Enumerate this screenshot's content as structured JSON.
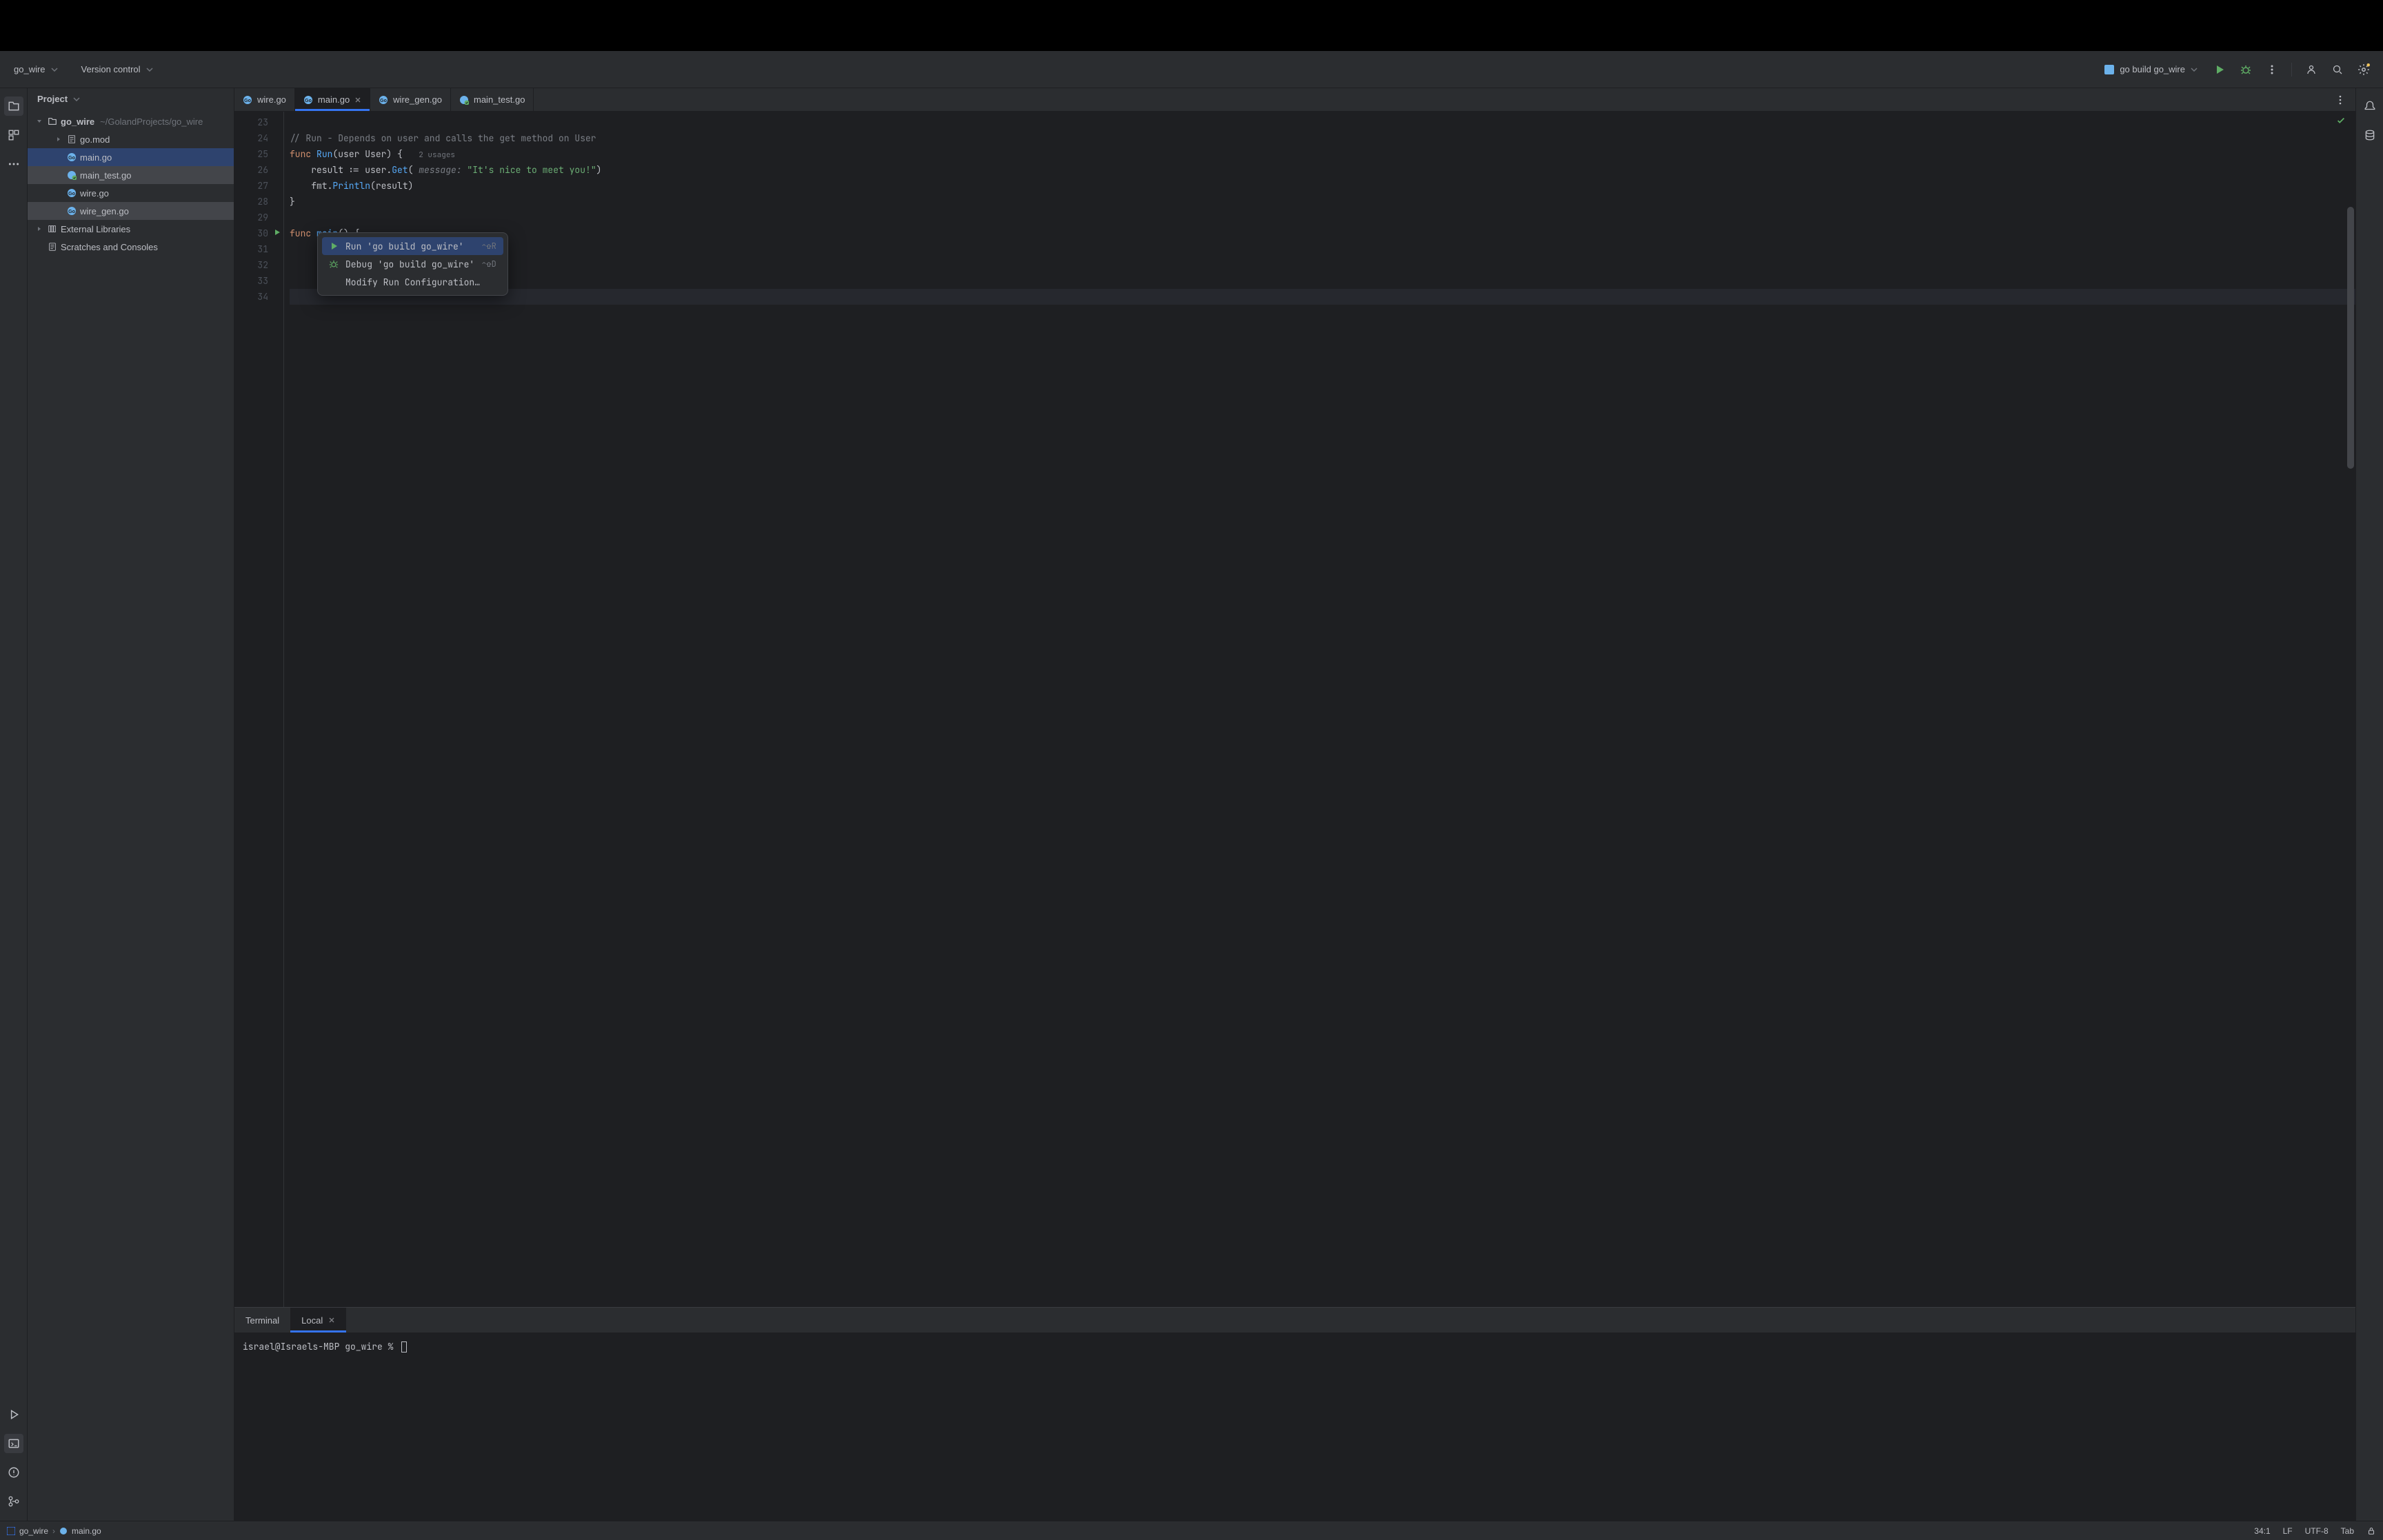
{
  "topbar": {
    "project_name": "go_wire",
    "version_control": "Version control",
    "run_config": "go build go_wire"
  },
  "project_panel": {
    "title": "Project",
    "root": {
      "name": "go_wire",
      "path": "~/GolandProjects/go_wire"
    },
    "files": [
      {
        "name": "go.mod",
        "icon": "pkg"
      },
      {
        "name": "main.go",
        "icon": "go",
        "selected": true
      },
      {
        "name": "main_test.go",
        "icon": "test",
        "highlighted": true
      },
      {
        "name": "wire.go",
        "icon": "go"
      },
      {
        "name": "wire_gen.go",
        "icon": "go",
        "highlighted": true
      }
    ],
    "external_libs": "External Libraries",
    "scratches": "Scratches and Consoles"
  },
  "tabs": [
    {
      "name": "wire.go",
      "icon": "go"
    },
    {
      "name": "main.go",
      "icon": "go",
      "active": true,
      "closeable": true
    },
    {
      "name": "wire_gen.go",
      "icon": "go"
    },
    {
      "name": "main_test.go",
      "icon": "test"
    }
  ],
  "editor": {
    "lines": [
      {
        "n": 23,
        "seg": [
          [
            "",
            ""
          ]
        ]
      },
      {
        "n": 24,
        "seg": [
          [
            "c-comment",
            "// Run - Depends on user and calls the get method on User"
          ]
        ]
      },
      {
        "n": 25,
        "seg": [
          [
            "c-keyword",
            "func "
          ],
          [
            "c-func",
            "Run"
          ],
          [
            "",
            "(user User) {   "
          ],
          [
            "c-usage",
            "2 usages"
          ]
        ]
      },
      {
        "n": 26,
        "seg": [
          [
            "",
            "    result := user."
          ],
          [
            "c-func",
            "Get"
          ],
          [
            "",
            "( "
          ],
          [
            "c-hint",
            "message: "
          ],
          [
            "c-string",
            "\"It's nice to meet you!\""
          ],
          [
            "",
            ")"
          ]
        ]
      },
      {
        "n": 27,
        "seg": [
          [
            "",
            "    fmt."
          ],
          [
            "c-func",
            "Println"
          ],
          [
            "",
            "(result)"
          ]
        ]
      },
      {
        "n": 28,
        "seg": [
          [
            "",
            "}"
          ]
        ]
      },
      {
        "n": 29,
        "seg": [
          [
            "",
            ""
          ]
        ]
      },
      {
        "n": 30,
        "seg": [
          [
            "c-keyword",
            "func "
          ],
          [
            "c-func",
            "main"
          ],
          [
            "",
            "() {"
          ]
        ],
        "has_play": true
      },
      {
        "n": 31,
        "seg": [
          [
            "",
            ""
          ]
        ]
      },
      {
        "n": 32,
        "seg": [
          [
            "",
            ""
          ]
        ]
      },
      {
        "n": 33,
        "seg": [
          [
            "",
            ""
          ]
        ]
      },
      {
        "n": 34,
        "seg": [
          [
            "",
            ""
          ]
        ],
        "current": true
      }
    ]
  },
  "context_menu": {
    "items": [
      {
        "icon": "play",
        "label": "Run 'go build go_wire'",
        "shortcut": "⌃⇧R",
        "selected": true
      },
      {
        "icon": "bug",
        "label": "Debug 'go build go_wire'",
        "shortcut": "⌃⇧D"
      },
      {
        "icon": "",
        "label": "Modify Run Configuration…",
        "shortcut": ""
      }
    ]
  },
  "terminal": {
    "title": "Terminal",
    "tab": "Local",
    "prompt": "israel@Israels-MBP go_wire % "
  },
  "statusbar": {
    "breadcrumb": [
      "go_wire",
      "main.go"
    ],
    "cursor": "34:1",
    "line_ending": "LF",
    "encoding": "UTF-8",
    "indent": "Tab"
  }
}
